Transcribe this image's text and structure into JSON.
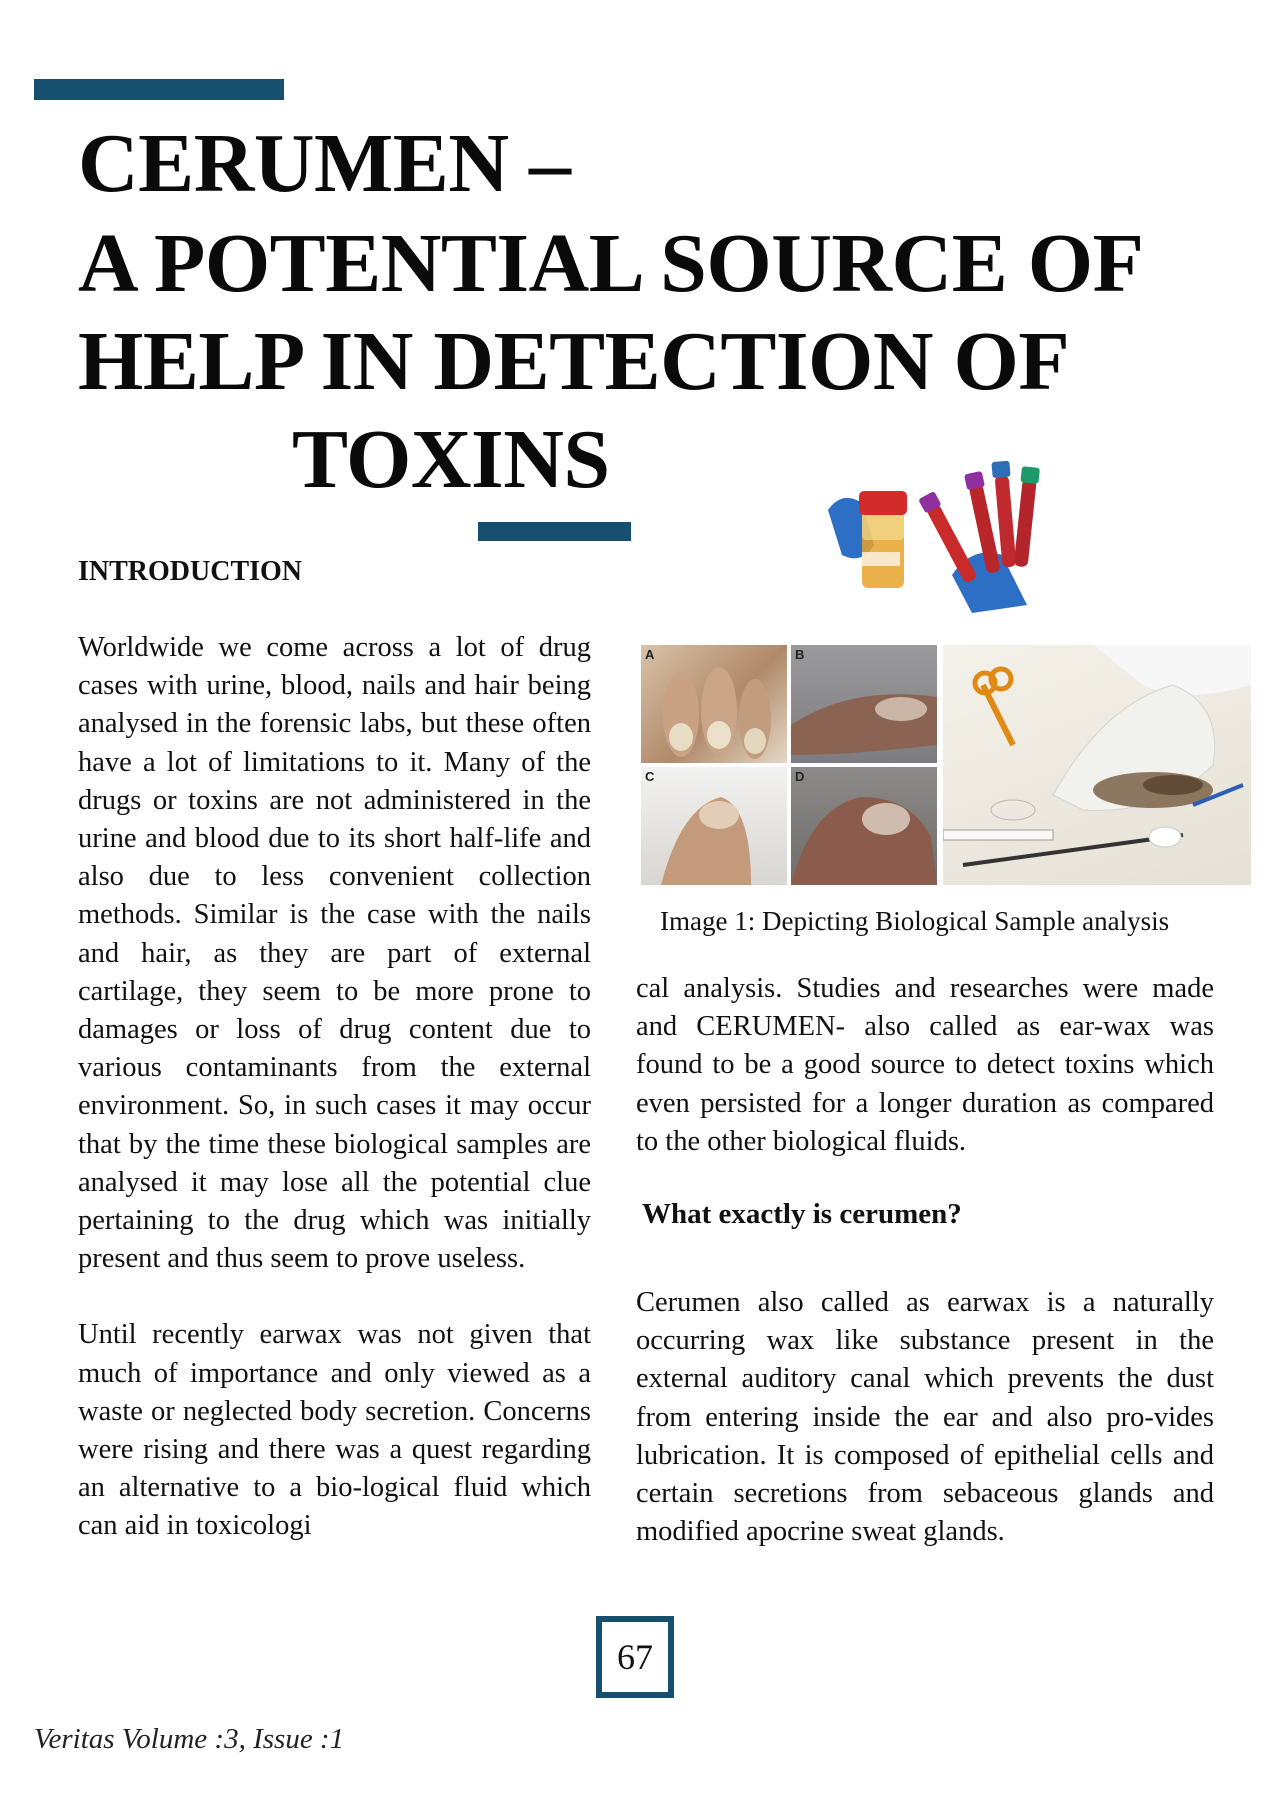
{
  "title": {
    "line1": "CERUMEN –",
    "line2": "A POTENTIAL SOURCE OF",
    "line3": "HELP IN DETECTION OF",
    "line4": "TOXINS"
  },
  "intro_heading": "INTRODUCTION",
  "left_column": {
    "para1": "Worldwide we come across a lot of drug cases with urine, blood, nails and hair being analysed in the forensic labs, but these often have a lot of limitations to it.  Many of the drugs or toxins are not administered in the urine and blood due to its short half-life and also due to less convenient collection methods. Similar is the case with the nails and hair, as they are part of external cartilage, they seem to be more prone to damages or loss of drug content due to various contaminants from the external environment. So, in such cases it may occur that by the time these biological samples are analysed it may lose all the potential clue pertaining to the drug which was initially present and thus seem to prove useless.",
    "para2": "Until recently earwax was not given that much of importance and only viewed as a waste or neglected body secretion. Concerns were rising and there was a quest regarding an alternative to a bio-logical fluid which can aid in toxicologi"
  },
  "figure": {
    "caption": "Image 1: Depicting Biological Sample analysis",
    "panel_labels": [
      "A",
      "B",
      "C",
      "D"
    ]
  },
  "right_column": {
    "para1": "cal analysis. Studies and researches were made and CERUMEN- also called as ear-wax was found to be a good source to detect toxins which even persisted for a longer duration as compared to the other biological fluids.",
    "question_heading": "What exactly is cerumen?",
    "para2": "Cerumen also called as earwax is a naturally occurring wax like substance present in the external auditory canal which prevents the dust from entering inside the ear and also pro-vides lubrication. It is composed of epithelial cells and certain secretions from sebaceous glands and modified apocrine sweat glands."
  },
  "page_number": "67",
  "footer": "Veritas Volume :3, Issue :1",
  "colors": {
    "accent_bar": "#17506e"
  }
}
